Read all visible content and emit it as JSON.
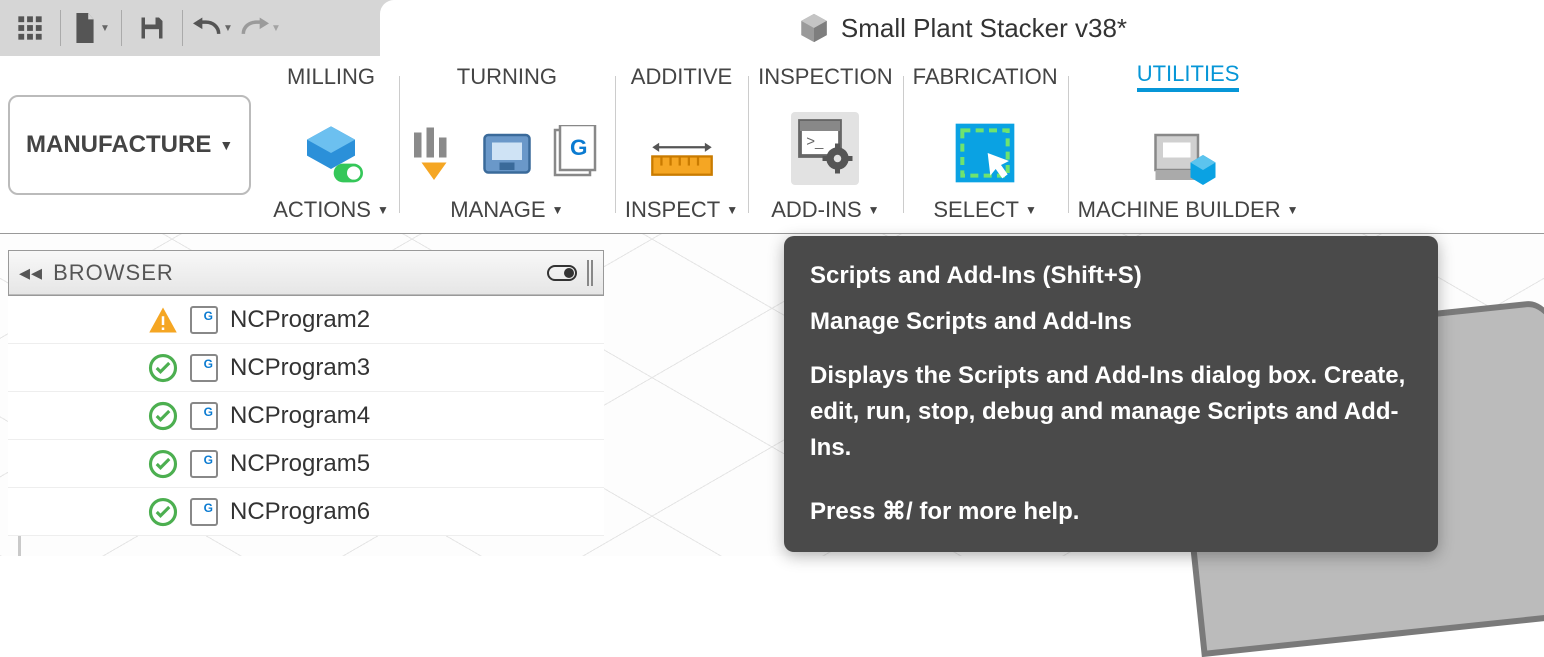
{
  "document": {
    "title": "Small Plant Stacker v38*"
  },
  "workspace": {
    "label": "MANUFACTURE"
  },
  "ribbon": {
    "tabs": [
      {
        "label": "MILLING",
        "footer": "ACTIONS"
      },
      {
        "label": "TURNING",
        "footer": "MANAGE"
      },
      {
        "label": "ADDITIVE",
        "footer": "INSPECT"
      },
      {
        "label": "INSPECTION",
        "footer": "ADD-INS"
      },
      {
        "label": "FABRICATION",
        "footer": "SELECT"
      },
      {
        "label": "UTILITIES",
        "footer": "MACHINE BUILDER",
        "active": true
      }
    ]
  },
  "browser": {
    "title": "BROWSER",
    "items": [
      {
        "status": "warn",
        "label": "NCProgram2"
      },
      {
        "status": "ok",
        "label": "NCProgram3"
      },
      {
        "status": "ok",
        "label": "NCProgram4"
      },
      {
        "status": "ok",
        "label": "NCProgram5"
      },
      {
        "status": "ok",
        "label": "NCProgram6"
      }
    ]
  },
  "tooltip": {
    "title": "Scripts and Add-Ins (Shift+S)",
    "subtitle": "Manage Scripts and Add-Ins",
    "body": "Displays the Scripts and Add-Ins dialog box. Create, edit, run, stop, debug and manage Scripts and Add-Ins.",
    "help": "Press ⌘/ for more help."
  }
}
